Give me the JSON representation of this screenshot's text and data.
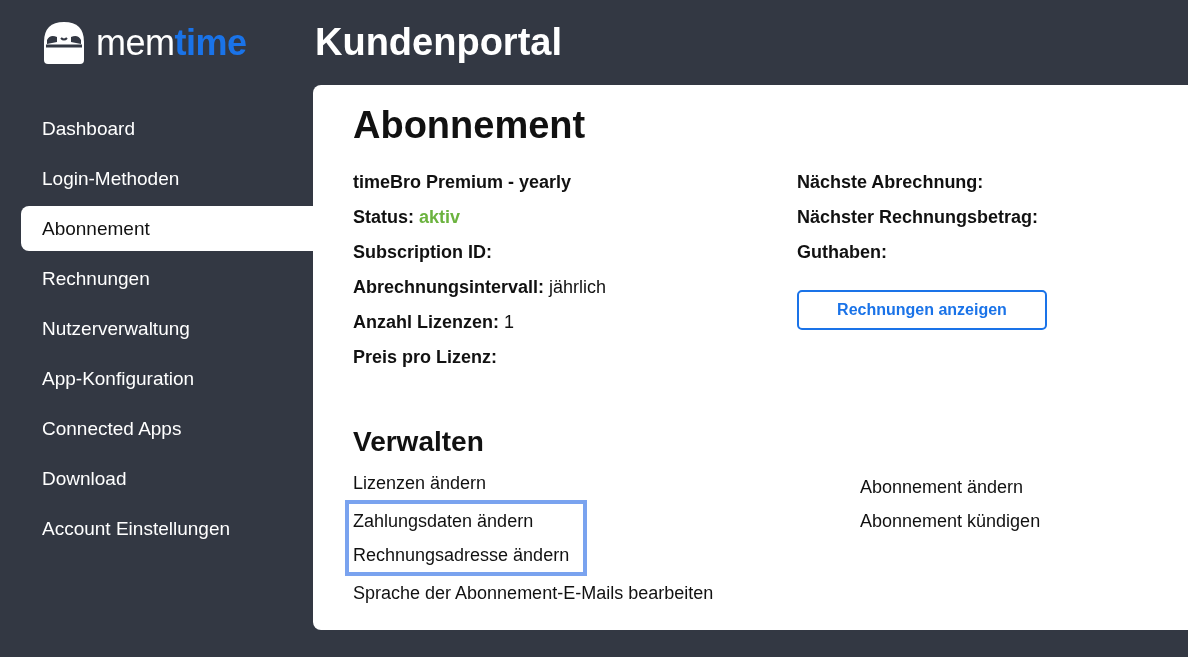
{
  "logo": {
    "part_1": "mem",
    "part_2": "time"
  },
  "header": {
    "title": "Kundenportal"
  },
  "sidebar": {
    "items": [
      {
        "label": "Dashboard",
        "selected": false
      },
      {
        "label": "Login-Methoden",
        "selected": false
      },
      {
        "label": "Abonnement",
        "selected": true
      },
      {
        "label": "Rechnungen",
        "selected": false
      },
      {
        "label": "Nutzerverwaltung",
        "selected": false
      },
      {
        "label": "App-Konfiguration",
        "selected": false
      },
      {
        "label": "Connected Apps",
        "selected": false
      },
      {
        "label": "Download",
        "selected": false
      },
      {
        "label": "Account Einstellungen",
        "selected": false
      }
    ]
  },
  "subscription": {
    "title": "Abonnement",
    "details_left": [
      {
        "label": "timeBro Premium - yearly"
      },
      {
        "label": "Status:",
        "value": "aktiv",
        "kind": "status"
      },
      {
        "label": "Subscription ID:"
      },
      {
        "label": "Abrechnungsintervall:",
        "value": "jährlich"
      },
      {
        "label": "Anzahl Lizenzen:",
        "value": "1"
      },
      {
        "label": "Preis pro Lizenz:"
      }
    ],
    "details_right": [
      {
        "label": "Nächste Abrechnung:"
      },
      {
        "label": "Nächster Rechnungsbetrag:"
      },
      {
        "label": "Guthaben:"
      }
    ],
    "invoices_button": "Rechnungen anzeigen"
  },
  "manage": {
    "title": "Verwalten",
    "links_left": [
      {
        "label": "Lizenzen ändern",
        "highlighted": false
      },
      {
        "label": "Zahlungsdaten ändern",
        "highlighted": true
      },
      {
        "label": "Rechnungsadresse ändern",
        "highlighted": true
      },
      {
        "label": "Sprache der Abonnement-E-Mails bearbeiten",
        "highlighted": false
      }
    ],
    "links_right": [
      {
        "label": "Abonnement ändern"
      },
      {
        "label": "Abonnement kündigen"
      }
    ]
  }
}
